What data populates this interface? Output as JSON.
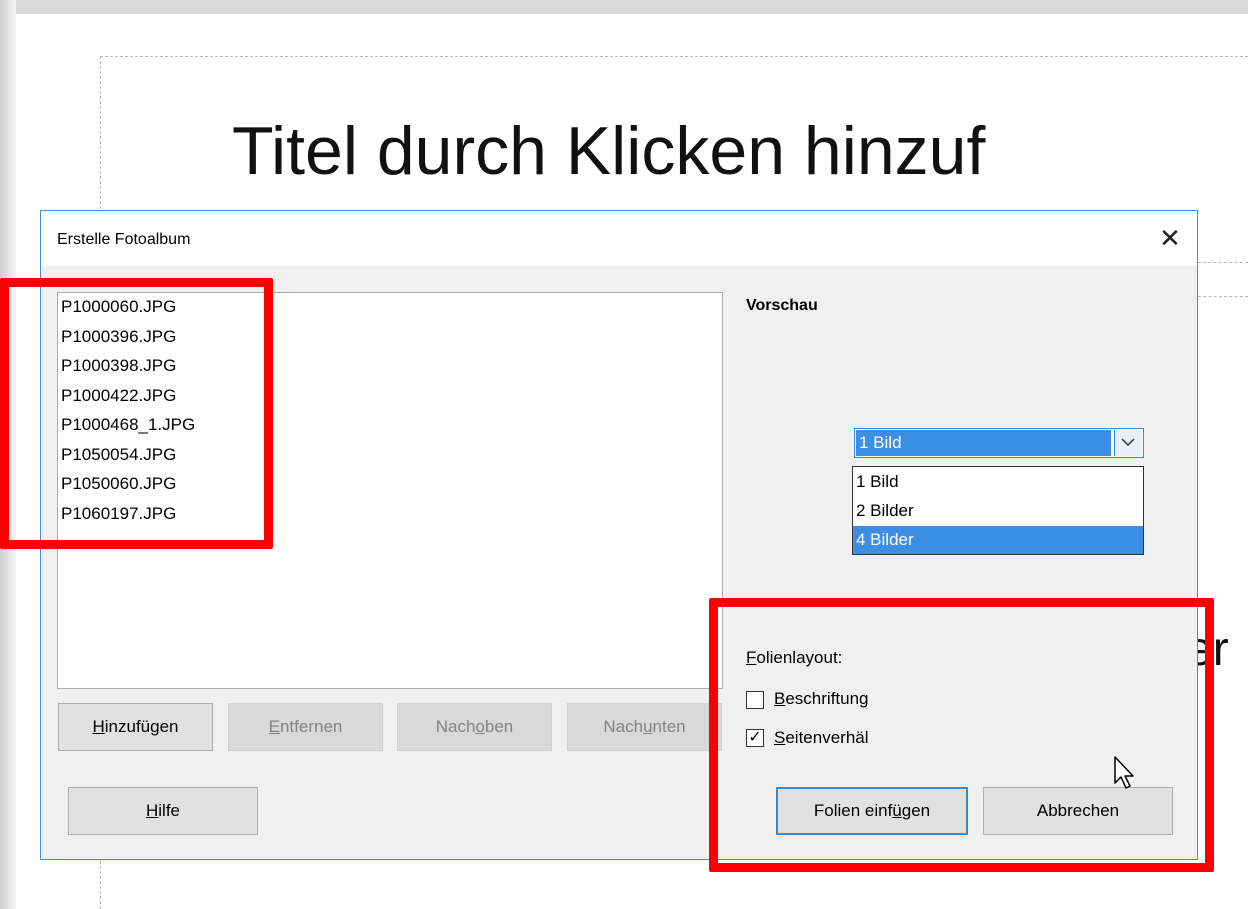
{
  "slide": {
    "title": "Titel durch Klicken hinzuf",
    "subtitle_fragment": "er"
  },
  "dialog": {
    "title": "Erstelle Fotoalbum",
    "close_glyph": "✕",
    "files": [
      "P1000060.JPG",
      "P1000396.JPG",
      "P1000398.JPG",
      "P1000422.JPG",
      "P1000468_1.JPG",
      "P1050054.JPG",
      "P1050060.JPG",
      "P1060197.JPG"
    ],
    "buttons": {
      "add": {
        "pre": "",
        "u": "H",
        "post": "inzufügen"
      },
      "remove": {
        "pre": "",
        "u": "E",
        "post": "ntfernen"
      },
      "up": {
        "pre": "Nach ",
        "u": "o",
        "post": "ben"
      },
      "down": {
        "pre": "Nach ",
        "u": "u",
        "post": "nten"
      },
      "help": {
        "pre": "",
        "u": "H",
        "post": "ilfe"
      },
      "insert": {
        "pre": "Folien einf",
        "u": "ü",
        "post": "gen"
      },
      "cancel": "Abbrechen"
    },
    "preview_label": "Vorschau",
    "layout": {
      "label_u": "F",
      "label_rest": "olienlayout:",
      "selected": "1 Bild",
      "options": [
        "1 Bild",
        "2 Bilder",
        "4 Bilder"
      ],
      "highlighted_option": "4 Bilder"
    },
    "captions": {
      "u": "B",
      "rest": "eschriftung",
      "checked": false
    },
    "aspect": {
      "u": "S",
      "rest": "eitenverhäl",
      "checked": true
    }
  },
  "colors": {
    "highlight": "#ff0000",
    "selection": "#3b8ee4",
    "dialog_border": "#4a8bd4"
  }
}
